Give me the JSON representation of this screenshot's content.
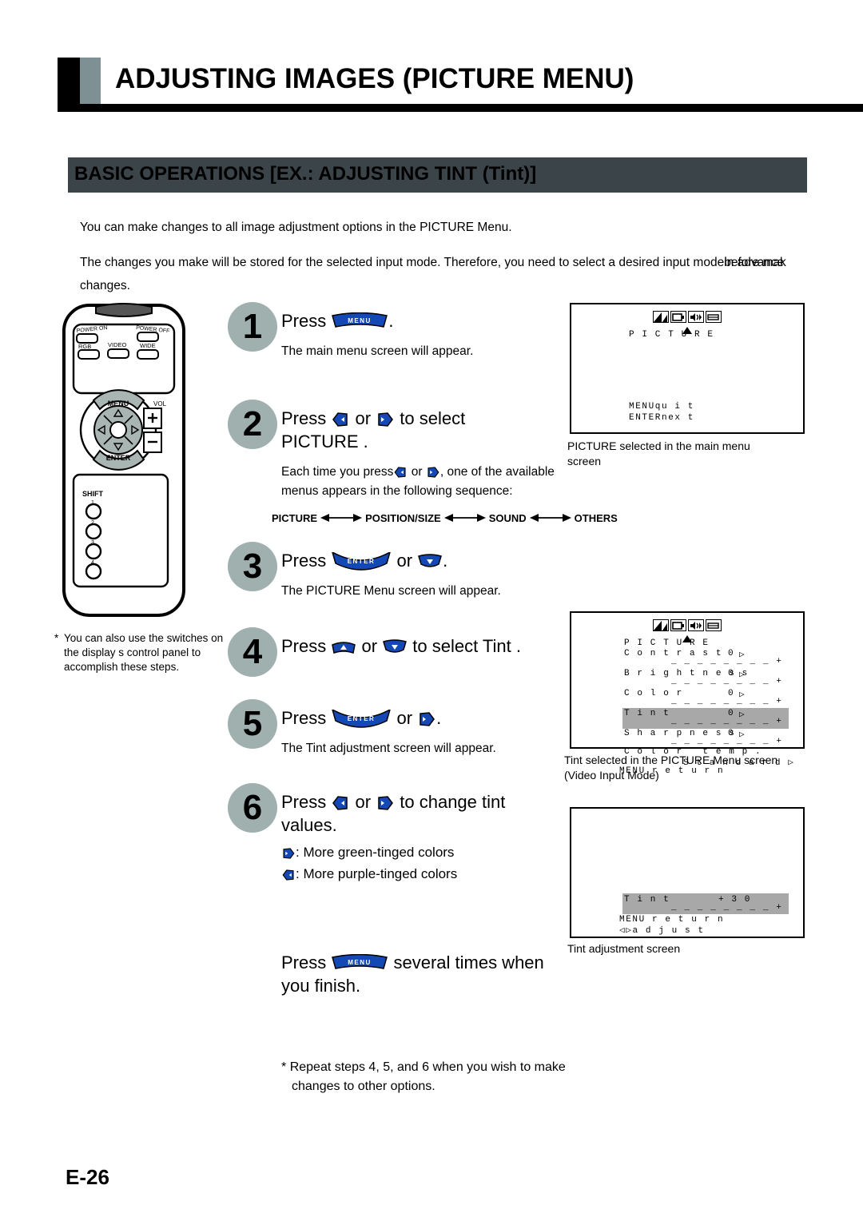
{
  "header": {
    "title": "ADJUSTING IMAGES (PICTURE MENU)",
    "bar_color": "#000000",
    "accent_color": "#7f9094"
  },
  "section": {
    "title": "BASIC OPERATIONS [EX.: ADJUSTING TINT (Tint)]",
    "bar_color": "#3b4449"
  },
  "intro": {
    "p1": "You can make changes to all image adjustment options in the PICTURE Menu.",
    "p2_a": "The changes you make will be stored for the selected input mode.  Therefore, you need to select a desired input mode",
    "p2_overlap_1": "in advance",
    "p2_overlap_2": "before mak",
    "p2_b": "changes."
  },
  "remote": {
    "name": "remote-control-illustration",
    "buttons": {
      "power_on": "POWER ON",
      "power_off": "POWER OFF",
      "rgb": "RGB",
      "video": "VIDEO",
      "wide": "WIDE",
      "menu": "MENU",
      "vol": "VOL",
      "vol_plus": "+",
      "vol_minus": "−",
      "enter": "ENTER",
      "shift": "SHIFT",
      "num1": "1",
      "num2": "2",
      "num3": "3",
      "num4": "4"
    },
    "note_star": "*",
    "note_text": "You can also use the switches on the display s control panel to accomplish these steps."
  },
  "steps": [
    {
      "number": "1",
      "main_pre": "Press ",
      "key": "MENU",
      "main_post": ".",
      "sub": "The main menu screen will appear."
    },
    {
      "number": "2",
      "main_pre": "Press ",
      "key_left": "left-arrow",
      "main_mid": " or ",
      "key_right": "right-arrow",
      "main_post": " to select",
      "main_line2": " PICTURE .",
      "sub_a": "Each time you press",
      "sub_b": " or ",
      "sub_c": ", one of the available",
      "sub_line2": "menus appears in the following sequence:",
      "sequence": [
        "PICTURE",
        "POSITION/SIZE",
        "SOUND",
        "OTHERS"
      ]
    },
    {
      "number": "3",
      "main_pre": "Press ",
      "key": "ENTER",
      "main_mid": " or ",
      "key2": "down-arrow",
      "main_post": ".",
      "sub": "The PICTURE Menu screen will appear."
    },
    {
      "number": "4",
      "main_pre": "Press ",
      "key": "up-arrow",
      "main_mid": " or ",
      "key2": "down-arrow",
      "main_post": " to select  Tint ."
    },
    {
      "number": "5",
      "main_pre": "Press ",
      "key": "ENTER",
      "main_mid": " or ",
      "key2": "right-arrow",
      "main_post": ".",
      "sub": "The  Tint  adjustment screen will appear."
    },
    {
      "number": "6",
      "main_pre": "Press ",
      "key_left": "left-arrow",
      "main_mid": " or ",
      "key_right": "right-arrow",
      "main_post": " to change tint",
      "main_line2": "values.",
      "legend_right": ": More green-tinged colors",
      "legend_left": ": More purple-tinged colors"
    }
  ],
  "finish": {
    "pre": "Press ",
    "key": "MENU",
    "post": " several times when",
    "line2": "you finish."
  },
  "repeat_note": {
    "star": "*",
    "line1": "Repeat steps 4, 5, and 6 when you wish to make",
    "line2": "changes to other options."
  },
  "osd": {
    "icons": [
      "picture-icon",
      "position-size-icon",
      "sound-icon",
      "others-icon"
    ],
    "screen1": {
      "title": "P I C T U R E",
      "footer1": "MENUqu i t",
      "footer2": "ENTERnex t",
      "caption_line1": " PICTURE  selected in the main menu",
      "caption_line2": "screen"
    },
    "screen2": {
      "title": "P I C T U R E",
      "rows": [
        {
          "label": "C o n t r a s t",
          "value": "0",
          "arrow": "▷",
          "highlight": false
        },
        {
          "label": "B r i g h t n e s s",
          "value": "0",
          "arrow": "▷",
          "highlight": false
        },
        {
          "label": "C o l o r",
          "value": "0",
          "arrow": "▷",
          "highlight": false
        },
        {
          "label": "T i n t",
          "value": "0",
          "arrow": "▷",
          "highlight": true
        },
        {
          "label": "S h a r p n e s s",
          "value": "0",
          "arrow": "▷",
          "highlight": false
        }
      ],
      "colortemp_label": "C o l o r   t e m p .",
      "colortemp_value": "S t a n d a r d ▷",
      "footer": "MENU r e t u r n",
      "slider_dashes": "_ _ _ _ _ _ _ _ +",
      "caption_line1": " Tint  selected in the PICTURE Menu screen",
      "caption_line2": "(Video Input Mode)"
    },
    "screen3": {
      "label": "T i n t",
      "value": "+ 3 0",
      "slider_dashes": "_ _ _ _ _ _ _ _ +",
      "footer1": "MENU r e t u r n",
      "footer2": "◁▷a d j u s t",
      "caption": "Tint  adjustment screen"
    }
  },
  "footer": {
    "page": "E-26"
  }
}
